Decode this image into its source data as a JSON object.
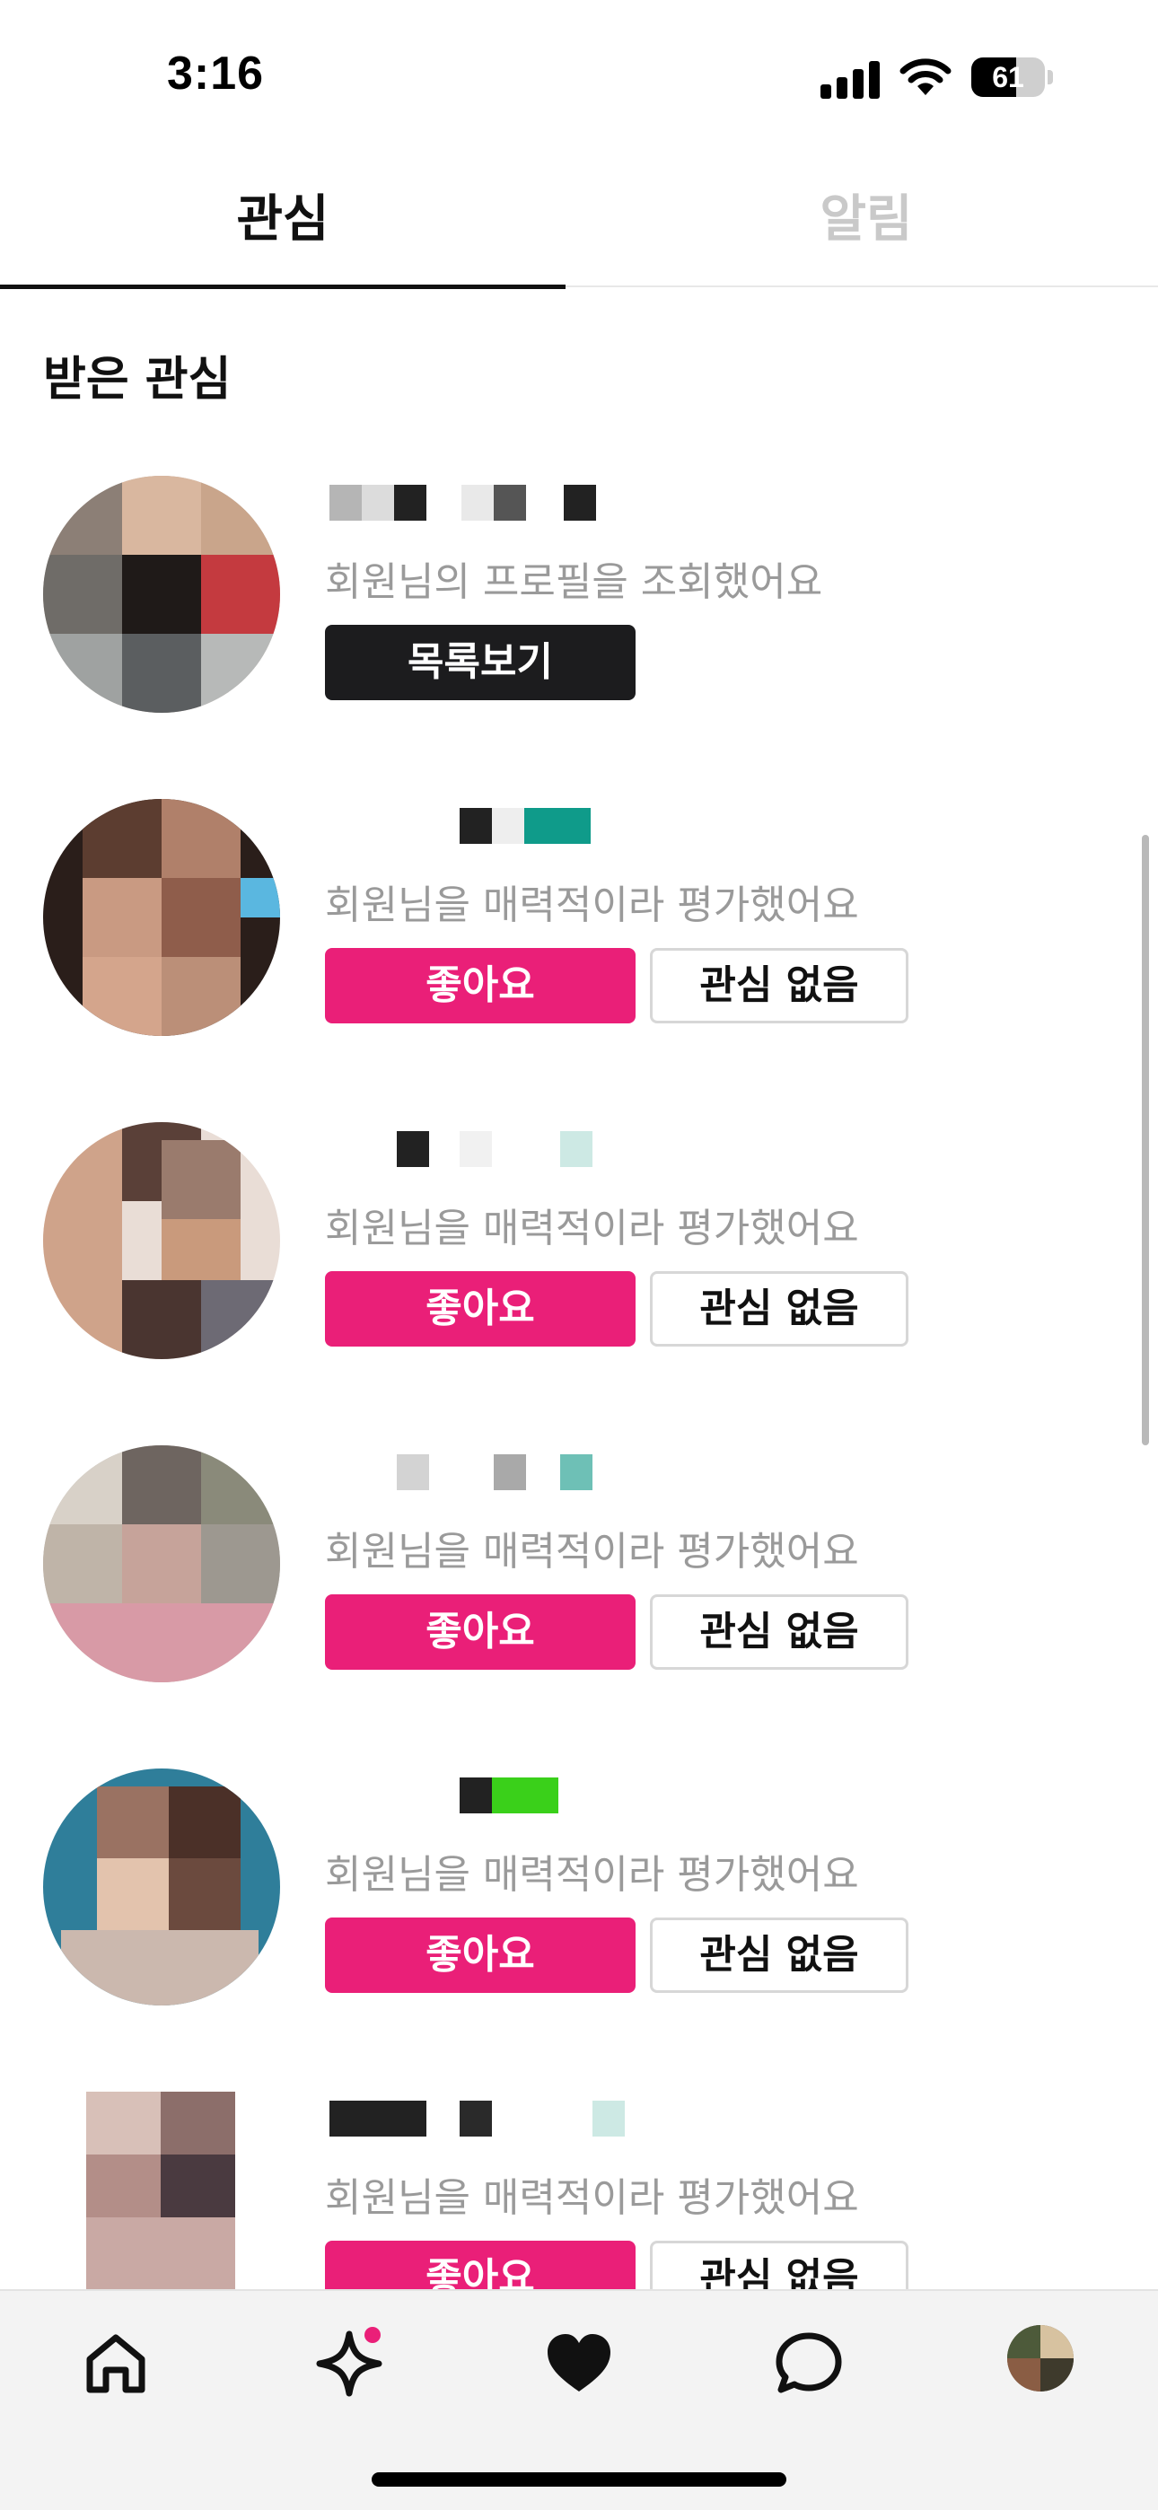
{
  "status_bar": {
    "time": "3:16",
    "battery_label": "61",
    "battery_level": 0.61,
    "icons": [
      "signal-icon",
      "wifi-icon",
      "battery-icon"
    ]
  },
  "tabs": [
    {
      "label": "관심",
      "active": true
    },
    {
      "label": "알림",
      "active": false
    }
  ],
  "section_title": "받은 관심",
  "cards": [
    {
      "message": "회원님의 프로필을 조회했어요",
      "buttons": [
        "목록보기"
      ]
    },
    {
      "message": "회원님을 매력적이라 평가했어요",
      "buttons": [
        "좋아요",
        "관심 없음"
      ]
    },
    {
      "message": "회원님을 매력적이라 평가했어요",
      "buttons": [
        "좋아요",
        "관심 없음"
      ]
    },
    {
      "message": "회원님을 매력적이라 평가했어요",
      "buttons": [
        "좋아요",
        "관심 없음"
      ]
    },
    {
      "message": "회원님을 매력적이라 평가했어요",
      "buttons": [
        "좋아요",
        "관심 없음"
      ]
    },
    {
      "message": "회원님을 매력적이라 평가했어요",
      "buttons": [
        "좋아요",
        "관심 없음"
      ]
    }
  ],
  "bottom_nav": {
    "items": [
      "home-icon",
      "sparkle-icon",
      "heart-icon",
      "chat-bubble-icon",
      "profile-avatar"
    ],
    "badge_on": "sparkle-icon"
  },
  "colors": {
    "accent_pink": "#ea1f78",
    "dark_button": "#1c1c1e",
    "muted_text": "#9a9a9a",
    "inactive_tab": "#c9c9c9"
  }
}
